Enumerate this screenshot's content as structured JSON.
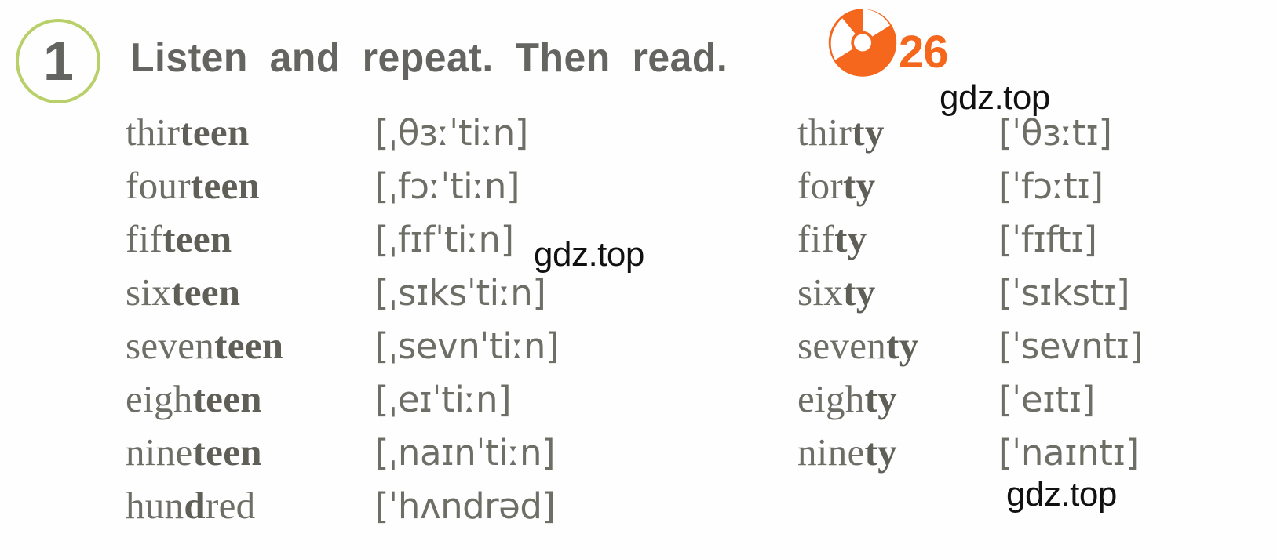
{
  "exercise": {
    "number": "1",
    "instruction": "Listen  and  repeat.  Then  read.",
    "badge_border_color": "#b9cf6a",
    "text_color": "#646460"
  },
  "audio": {
    "icon": "cd-disc-icon",
    "track_number": "26",
    "accent_color": "#f4671c"
  },
  "columns": {
    "left": [
      {
        "word_stem": "thir",
        "word_suffix": "teen",
        "ipa": "[ˌθɜːˈtiːn]"
      },
      {
        "word_stem": "four",
        "word_suffix": "teen",
        "ipa": "[ˌfɔːˈtiːn]"
      },
      {
        "word_stem": "fif",
        "word_suffix": "teen",
        "ipa": "[ˌfɪfˈtiːn]"
      },
      {
        "word_stem": "six",
        "word_suffix": "teen",
        "ipa": "[ˌsɪksˈtiːn]"
      },
      {
        "word_stem": "seven",
        "word_suffix": "teen",
        "ipa": "[ˌsevnˈtiːn]"
      },
      {
        "word_stem": "eigh",
        "word_suffix": "teen",
        "ipa": "[ˌeɪˈtiːn]"
      },
      {
        "word_stem": "nine",
        "word_suffix": "teen",
        "ipa": "[ˌnaɪnˈtiːn]"
      },
      {
        "word_stem": "hun",
        "word_suffix": "d",
        "word_tail": "red",
        "ipa": "[ˈhʌndrəd]"
      }
    ],
    "right": [
      {
        "word_stem": "thir",
        "word_suffix": "ty",
        "ipa": "[ˈθɜːtɪ]"
      },
      {
        "word_stem": "for",
        "word_suffix": "ty",
        "ipa": "[ˈfɔːtɪ]"
      },
      {
        "word_stem": "fif",
        "word_suffix": "ty",
        "ipa": "[ˈfɪftɪ]"
      },
      {
        "word_stem": "six",
        "word_suffix": "ty",
        "ipa": "[ˈsɪkstɪ]"
      },
      {
        "word_stem": "seven",
        "word_suffix": "ty",
        "ipa": "[ˈsevntɪ]"
      },
      {
        "word_stem": "eigh",
        "word_suffix": "ty",
        "ipa": "[ˈeɪtɪ]"
      },
      {
        "word_stem": "nine",
        "word_suffix": "ty",
        "ipa": "[ˈnaɪntɪ]"
      }
    ]
  },
  "watermarks": {
    "one": "gdz.top",
    "two": "gdz.top",
    "three": "gdz.top"
  }
}
